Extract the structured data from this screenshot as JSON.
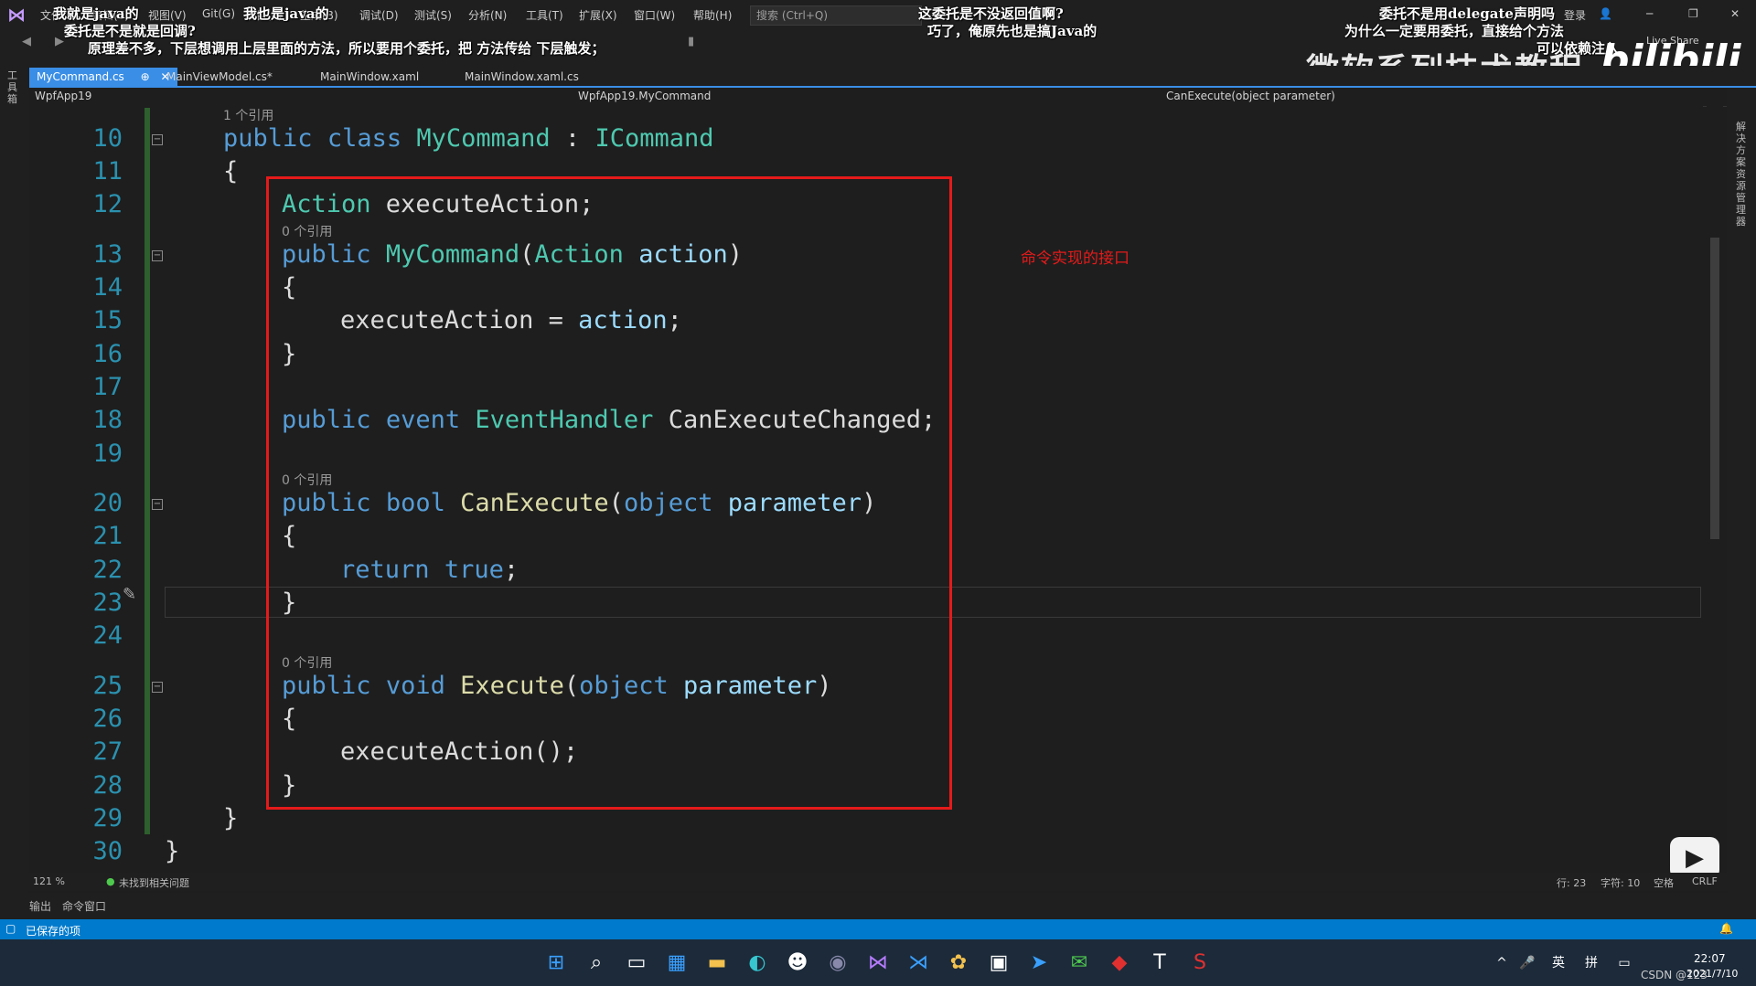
{
  "menubar": {
    "items": [
      "文件(F)",
      "编辑(E)",
      "视图(V)",
      "Git(G)",
      "项目(P)",
      "生成(B)",
      "调试(D)",
      "测试(S)",
      "分析(N)",
      "工具(T)",
      "扩展(X)",
      "窗口(W)",
      "帮助(H)"
    ],
    "search_placeholder": "搜索 (Ctrl+Q)",
    "login": "登录",
    "live_share": "Live Share"
  },
  "overlays": {
    "q1": "我就是java的",
    "q2": "我也是java的",
    "q3": "委托是不是就是回调?",
    "q4": "原理差不多，下层想调用上层里面的方法，所以要用个委托，把 方法传给 下层触发；",
    "q5": "这委托是不没返回值啊?",
    "q6": "巧了，俺原先也是搞Java的",
    "q7": "委托不是用delegate声明吗",
    "q8": "为什么一定要用委托，直接给个方法",
    "q9": "可以依赖注入",
    "brand": "微软系列技术教程",
    "bili": "bilibili"
  },
  "tabs": [
    {
      "label": "MyCommand.cs",
      "active": true,
      "pin": "⊕",
      "close": "✕"
    },
    {
      "label": "MainViewModel.cs*",
      "active": false
    },
    {
      "label": "MainWindow.xaml",
      "active": false
    },
    {
      "label": "MainWindow.xaml.cs",
      "active": false
    }
  ],
  "navbar": {
    "project": "WpfApp19",
    "class": "WpfApp19.MyCommand",
    "member": "CanExecute(object parameter)"
  },
  "code": {
    "ref_class": "1 个引用",
    "ref_ctor": "0 个引用",
    "ref_canexec": "0 个引用",
    "ref_exec": "0 个引用",
    "line_numbers": [
      "10",
      "11",
      "12",
      "13",
      "14",
      "15",
      "16",
      "17",
      "18",
      "19",
      "20",
      "21",
      "22",
      "23",
      "24",
      "25",
      "26",
      "27",
      "28",
      "29",
      "30"
    ],
    "l10": {
      "kw1": "public",
      "kw2": "class",
      "name": "MyCommand",
      "sep": " : ",
      "iface": "ICommand"
    },
    "l11": "{",
    "l12": {
      "type": "Action",
      "rest": " executeAction;"
    },
    "l13": {
      "kw": "public",
      "name": "MyCommand",
      "p1": "(",
      "type": "Action",
      "param": "action",
      "p2": ")"
    },
    "l14": "{",
    "l15": {
      "lhs": "executeAction = ",
      "rhs": "action",
      "end": ";"
    },
    "l16": "}",
    "l18": {
      "kw1": "public",
      "kw2": "event",
      "type": "EventHandler",
      "rest": " CanExecuteChanged;"
    },
    "l20": {
      "kw1": "public",
      "kw2": "bool",
      "name": "CanExecute",
      "p1": "(",
      "type": "object",
      "param": "parameter",
      "p2": ")"
    },
    "l21": "{",
    "l22": {
      "kw": "return",
      "val": "true",
      "end": ";"
    },
    "l23": "}",
    "l25": {
      "kw1": "public",
      "kw2": "void",
      "name": "Execute",
      "p1": "(",
      "type": "object",
      "param": "parameter",
      "p2": ")"
    },
    "l26": "{",
    "l27": "executeAction();",
    "l28": "}",
    "l29": "}",
    "l30": "}"
  },
  "annotation": "命令实现的接口",
  "editor_status": {
    "zoom": "121 %",
    "issues": "未找到相关问题",
    "row": "行: 23",
    "col": "字符: 10",
    "space": "空格",
    "crlf": "CRLF"
  },
  "panel_tabs": [
    "输出",
    "命令窗口"
  ],
  "statusbar": {
    "saved": "已保存的项"
  },
  "tray": {
    "lang1": "英",
    "lang2": "拼",
    "time": "22:07",
    "date": "2021/7/10",
    "csdn": "CSDN @123"
  },
  "sidebar_left": "工具箱",
  "sidebar_right": "解决方案资源管理器",
  "colors": {
    "accent": "#007acc",
    "red_box": "#e51a1a",
    "keyword": "#569cd6",
    "type": "#4ec9b0",
    "method": "#dcdcaa",
    "param": "#9cdcfe"
  }
}
